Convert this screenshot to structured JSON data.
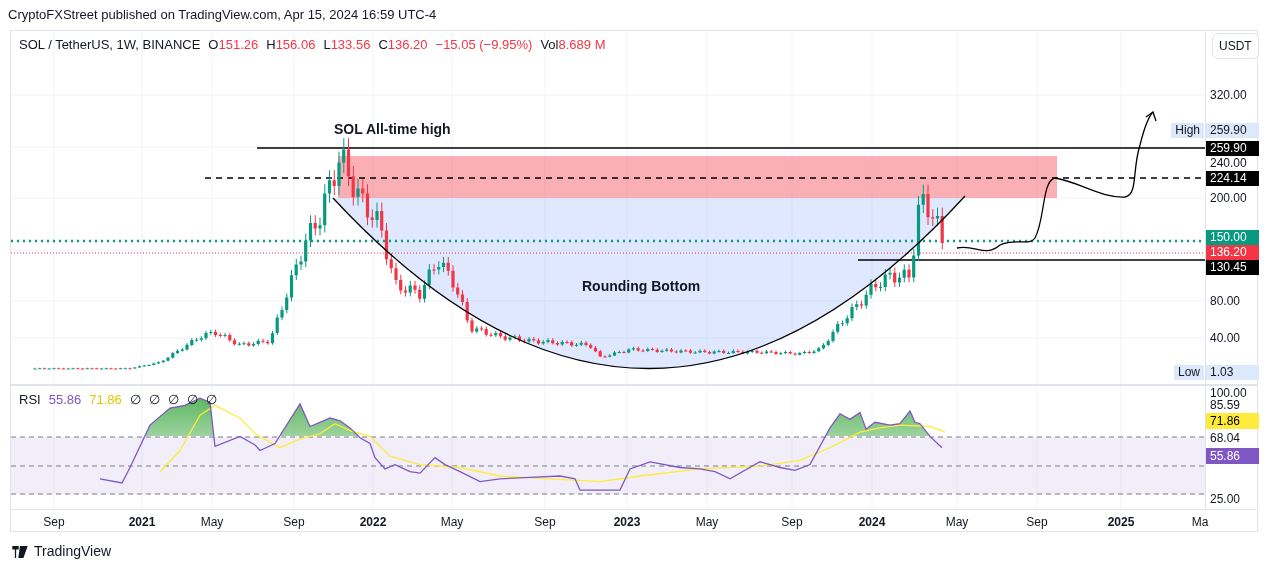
{
  "attribution": "CryptoFXStreet published on TradingView.com, Apr 15, 2024 16:59 UTC-4",
  "legend": {
    "symbol": "SOL / TetherUS, 1W, BINANCE",
    "ohlc": [
      {
        "key": "O",
        "value": "151.26"
      },
      {
        "key": "H",
        "value": "156.06"
      },
      {
        "key": "L",
        "value": "133.56"
      },
      {
        "key": "C",
        "value": "136.20"
      }
    ],
    "change": "−15.05 (−9.95%)",
    "volume": {
      "key": "Vol",
      "value": "8.689 M"
    }
  },
  "currency_button": "USDT",
  "annotations": [
    {
      "kind": "title",
      "text": "SOL All-time high"
    },
    {
      "kind": "label",
      "text": "Rounding Bottom"
    }
  ],
  "price_axis": {
    "labels": [
      "320.00",
      "240.00",
      "200.00",
      "80.00",
      "40.00"
    ],
    "tags": [
      {
        "kind": "extreme",
        "label": "High",
        "value": "259.90"
      },
      {
        "kind": "line",
        "value": "259.90",
        "color": "#000000"
      },
      {
        "kind": "line",
        "value": "224.14",
        "color": "#000000"
      },
      {
        "kind": "line",
        "value": "150.00",
        "color": "#089981"
      },
      {
        "kind": "line",
        "value": "136.20",
        "color": "#f23645"
      },
      {
        "kind": "line",
        "value": "130.45",
        "color": "#000000"
      },
      {
        "kind": "extreme",
        "label": "Low",
        "value": "1.03"
      }
    ]
  },
  "rsi": {
    "title": "RSI",
    "value": "55.86",
    "ma_value": "71.86",
    "extras": [
      "∅",
      "∅",
      "∅",
      "∅",
      "∅"
    ],
    "axis_labels": [
      "100.00",
      "85.59",
      "68.04",
      "25.00"
    ],
    "tags": [
      {
        "value": "71.86",
        "color": "#ffeb3b"
      },
      {
        "value": "55.86",
        "color": "#7e57c2"
      }
    ]
  },
  "time_axis": [
    {
      "label": "Sep",
      "kind": "month"
    },
    {
      "label": "2021",
      "kind": "year"
    },
    {
      "label": "May",
      "kind": "month"
    },
    {
      "label": "Sep",
      "kind": "month"
    },
    {
      "label": "2022",
      "kind": "year"
    },
    {
      "label": "May",
      "kind": "month"
    },
    {
      "label": "Sep",
      "kind": "month"
    },
    {
      "label": "2023",
      "kind": "year"
    },
    {
      "label": "May",
      "kind": "month"
    },
    {
      "label": "Sep",
      "kind": "month"
    },
    {
      "label": "2024",
      "kind": "year"
    },
    {
      "label": "May",
      "kind": "month"
    },
    {
      "label": "Sep",
      "kind": "month"
    },
    {
      "label": "2025",
      "kind": "year"
    },
    {
      "label": "Ma",
      "kind": "month"
    }
  ],
  "footer": {
    "brand": "TradingView"
  }
}
